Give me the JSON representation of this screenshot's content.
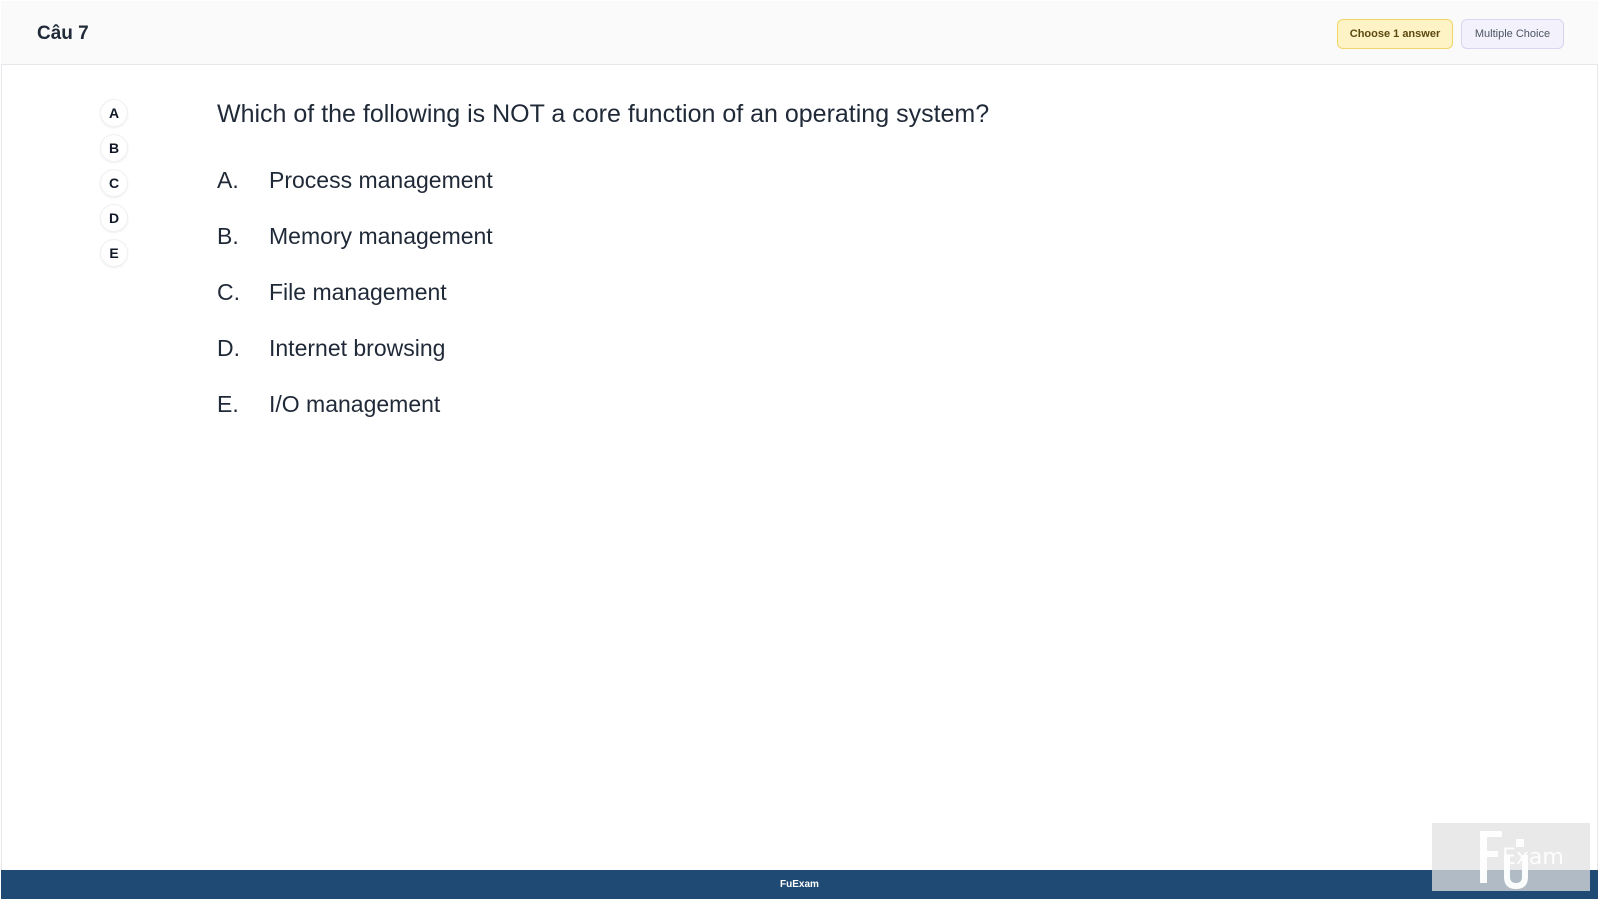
{
  "header": {
    "question_number": "Câu 7",
    "choose_badge": "Choose 1 answer",
    "type_badge": "Multiple Choice"
  },
  "answer_nav": [
    "A",
    "B",
    "C",
    "D",
    "E"
  ],
  "question": {
    "text": "Which of the following is NOT a core function of an operating system?",
    "options": [
      {
        "letter": "A.",
        "text": "Process management"
      },
      {
        "letter": "B.",
        "text": "Memory management"
      },
      {
        "letter": "C.",
        "text": "File management"
      },
      {
        "letter": "D.",
        "text": "Internet browsing"
      },
      {
        "letter": "E.",
        "text": "I/O management"
      }
    ]
  },
  "footer": {
    "brand": "FuExam"
  },
  "watermark": {
    "text": "Exam",
    "icon": "fu-exam-logo-icon"
  }
}
